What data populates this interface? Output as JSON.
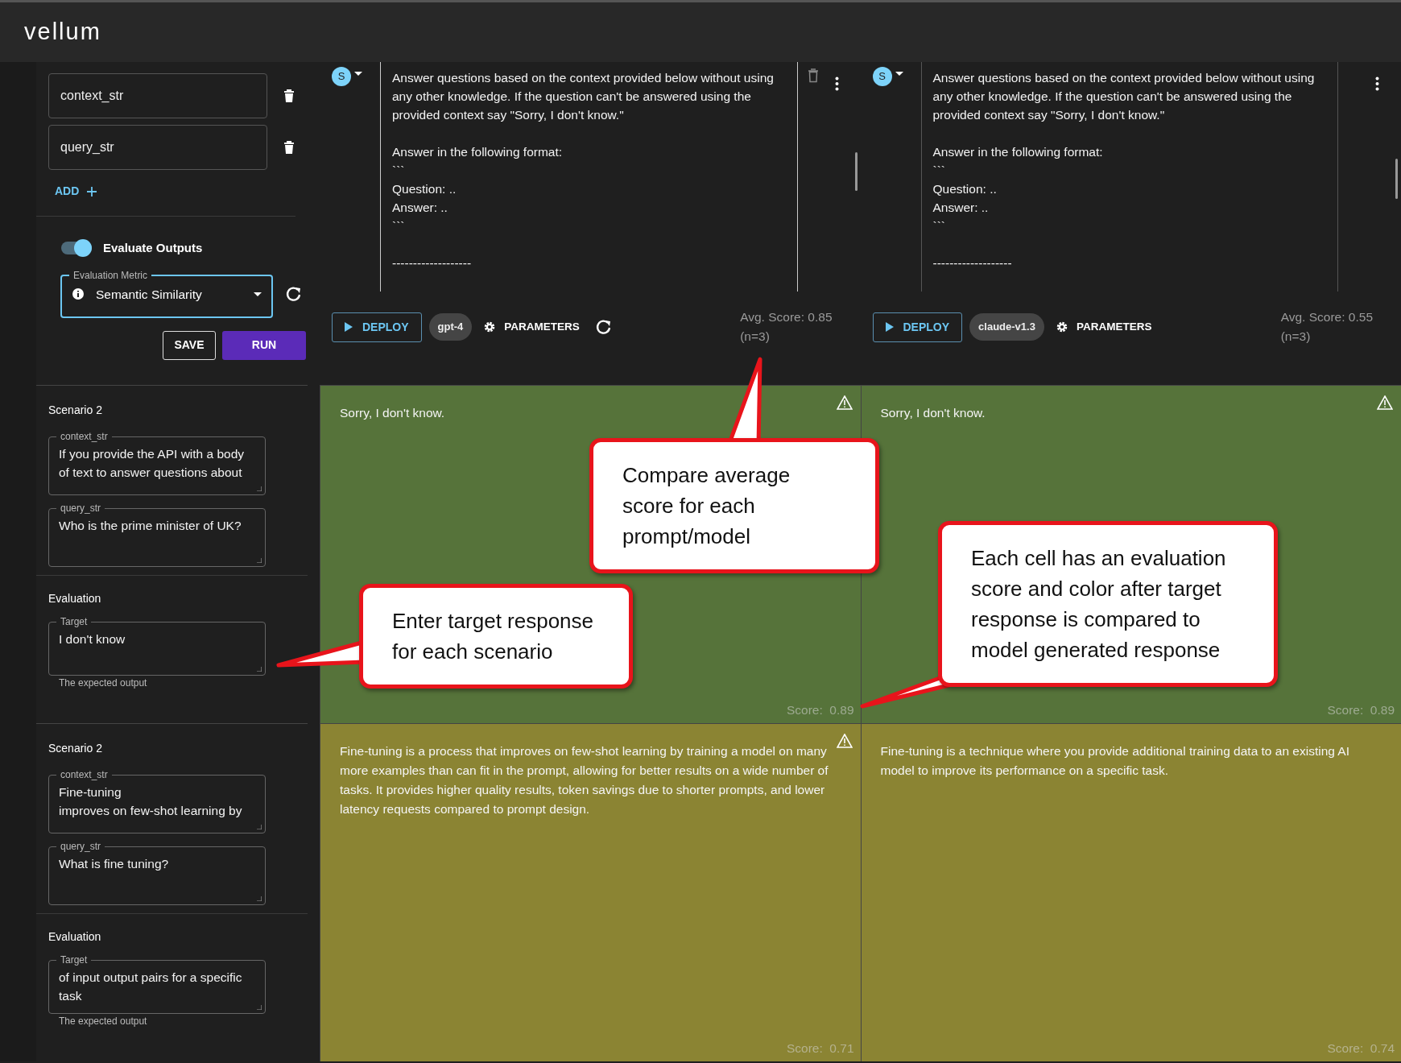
{
  "app": {
    "logo": "vellum"
  },
  "variables": [
    {
      "name": "context_str"
    },
    {
      "name": "query_str"
    }
  ],
  "add_button": "ADD",
  "evaluate_toggle": {
    "label": "Evaluate Outputs",
    "on": true
  },
  "metric": {
    "label": "Evaluation Metric",
    "value": "Semantic Similarity"
  },
  "actions": [
    "SAVE",
    "RUN"
  ],
  "prompts": [
    {
      "avatar": "S",
      "text": "Answer questions based on the context provided below without using any other knowledge. If the question can't be answered using the provided context say \"Sorry, I don't know.\"\n\nAnswer in the following format:\n```\nQuestion: ..\nAnswer: ..\n```\n\n-------------------",
      "deploy": "DEPLOY",
      "model": "gpt-4",
      "parameters": "PARAMETERS",
      "avg_score": "Avg. Score: 0.85",
      "n": "(n=3)",
      "delete": true,
      "refresh": true
    },
    {
      "avatar": "S",
      "text": "Answer questions based on the context provided below without using any other knowledge. If the question can't be answered using the provided context say \"Sorry, I don't know.\"\n\nAnswer in the following format:\n```\nQuestion: ..\nAnswer: ..\n```\n\n-------------------",
      "deploy": "DEPLOY",
      "model": "claude-v1.3",
      "parameters": "PARAMETERS",
      "avg_score": "Avg. Score: 0.55",
      "n": "(n=3)",
      "delete": false,
      "refresh": false
    }
  ],
  "scenarios": [
    {
      "title": "Scenario 2",
      "inputs": [
        {
          "label": "context_str",
          "value": "If you provide the API with a body of text to answer questions about"
        },
        {
          "label": "query_str",
          "value": "Who is the prime minister of UK?"
        }
      ],
      "evaluation_title": "Evaluation",
      "target": {
        "label": "Target",
        "value": "I don't know",
        "helper": "The expected output"
      },
      "results": [
        {
          "text": "Sorry, I don't know.",
          "score": "Score:  0.89",
          "color": "#56733a",
          "warning": true
        },
        {
          "text": "Sorry, I don't know.",
          "score": "Score:  0.89",
          "color": "#56733a",
          "warning": true
        }
      ]
    },
    {
      "title": "Scenario 2",
      "inputs": [
        {
          "label": "context_str",
          "value": "Fine-tuning\nimproves on few-shot learning by"
        },
        {
          "label": "query_str",
          "value": "What is fine tuning?"
        }
      ],
      "evaluation_title": "Evaluation",
      "target": {
        "label": "Target",
        "value": "of input output pairs for a specific task",
        "helper": "The expected output"
      },
      "results": [
        {
          "text": "Fine-tuning is a process that improves on few-shot learning by training a model on many more examples than can fit in the prompt, allowing for better results on a wide number of tasks. It provides higher quality results, token savings due to shorter prompts, and lower latency requests compared to prompt design.",
          "score": "Score:  0.71",
          "color": "#8b8433",
          "warning": true
        },
        {
          "text": " Fine-tuning is a technique where you provide additional training data to an existing AI model to improve its performance on a specific task.",
          "score": "Score:  0.74",
          "color": "#8b8433",
          "warning": false
        }
      ]
    }
  ],
  "callouts": [
    {
      "text": "Compare average score for each prompt/model"
    },
    {
      "text": "Enter target response for each scenario"
    },
    {
      "text": "Each cell has an evaluation score and color after target response is compared to model generated response"
    }
  ]
}
